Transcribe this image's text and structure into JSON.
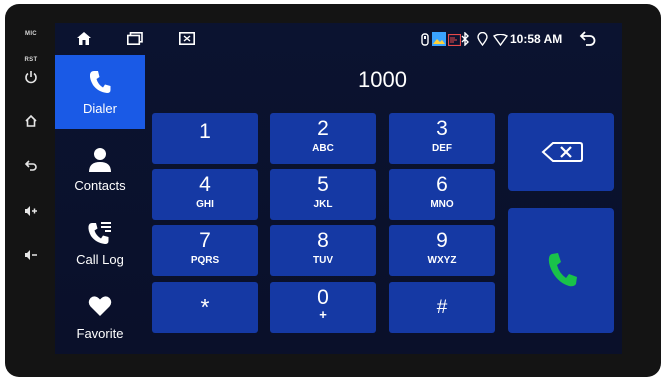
{
  "device": {
    "side_buttons": [
      {
        "label": "MIC",
        "icon": "mic-hole"
      },
      {
        "label": "RST",
        "icon": "reset-hole"
      },
      {
        "icon": "power-icon"
      },
      {
        "icon": "home-icon"
      },
      {
        "icon": "back-icon"
      },
      {
        "icon": "volume-up-icon"
      },
      {
        "icon": "volume-down-icon"
      }
    ]
  },
  "status_bar": {
    "time": "10:58 AM",
    "icons": [
      "home-icon",
      "recent-apps-icon",
      "screen-icon",
      "usb-icon",
      "gallery-icon",
      "cast-icon",
      "bluetooth-icon",
      "location-icon",
      "wifi-icon",
      "back-icon"
    ]
  },
  "nav": {
    "items": [
      {
        "label": "Dialer",
        "icon": "phone-icon",
        "active": true
      },
      {
        "label": "Contacts",
        "icon": "person-icon",
        "active": false
      },
      {
        "label": "Call Log",
        "icon": "call-log-icon",
        "active": false
      },
      {
        "label": "Favorite",
        "icon": "heart-icon",
        "active": false
      }
    ]
  },
  "dialer": {
    "number": "1000",
    "keys": [
      {
        "digit": "1",
        "letters": ""
      },
      {
        "digit": "2",
        "letters": "ABC"
      },
      {
        "digit": "3",
        "letters": "DEF"
      },
      {
        "digit": "4",
        "letters": "GHI"
      },
      {
        "digit": "5",
        "letters": "JKL"
      },
      {
        "digit": "6",
        "letters": "MNO"
      },
      {
        "digit": "7",
        "letters": "PQRS"
      },
      {
        "digit": "8",
        "letters": "TUV"
      },
      {
        "digit": "9",
        "letters": "WXYZ"
      },
      {
        "digit": "*",
        "letters": ""
      },
      {
        "digit": "0",
        "letters": "+"
      },
      {
        "digit": "#",
        "letters": ""
      }
    ],
    "backspace_icon": "backspace-icon",
    "call_icon": "call-icon"
  },
  "colors": {
    "screen_bg": "#0b1330",
    "key_bg": "#1539a4",
    "active_nav": "#1a5ae6",
    "call_green": "#19c24a"
  }
}
